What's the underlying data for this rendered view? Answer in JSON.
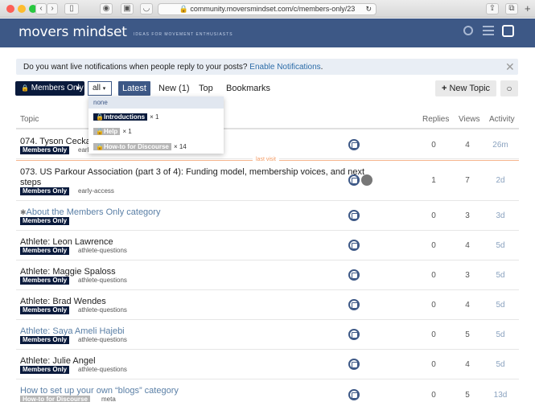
{
  "browser": {
    "url": "community.moversmindset.com/c/members-only/23"
  },
  "site": {
    "logo": "movers mindset",
    "tagline": "IDEAS FOR MOVEMENT ENTHUSIASTS"
  },
  "notice": {
    "text": "Do you want live notifications when people reply to your posts?",
    "link": "Enable Notifications",
    "tail": "."
  },
  "nav": {
    "category": "Members Only",
    "filter": "all",
    "latest": "Latest",
    "new": "New (1)",
    "top": "Top",
    "bookmarks": "Bookmarks",
    "new_topic": "New Topic"
  },
  "columns": {
    "topic": "Topic",
    "replies": "Replies",
    "views": "Views",
    "activity": "Activity"
  },
  "dropdown": {
    "none": "none",
    "items": [
      {
        "label": "Introductions",
        "count": "× 1"
      },
      {
        "label": "Help",
        "count": "× 1"
      },
      {
        "label": "How-to for Discourse",
        "count": "× 14"
      }
    ]
  },
  "last_visit": "last visit",
  "topics": [
    {
      "title": "074. Tyson Cecka: C",
      "badge": "Members Only",
      "tag": "early",
      "replies": "0",
      "views": "4",
      "activity": "26m"
    },
    {
      "title": "073. US Parkour Association (part 3 of 4): Funding model, membership voices, and next",
      "title2": "steps",
      "badge": "Members Only",
      "tag": "early-access",
      "replies": "1",
      "views": "7",
      "activity": "2d"
    },
    {
      "title": "About the Members Only category",
      "badge": "Members Only",
      "tag": "",
      "replies": "0",
      "views": "3",
      "activity": "3d"
    },
    {
      "title": "Athlete: Leon Lawrence",
      "badge": "Members Only",
      "tag": "athlete-questions",
      "replies": "0",
      "views": "4",
      "activity": "5d"
    },
    {
      "title": "Athlete: Maggie Spaloss",
      "badge": "Members Only",
      "tag": "athlete-questions",
      "replies": "0",
      "views": "3",
      "activity": "5d"
    },
    {
      "title": "Athlete: Brad Wendes",
      "badge": "Members Only",
      "tag": "athlete-questions",
      "replies": "0",
      "views": "4",
      "activity": "5d"
    },
    {
      "title": "Athlete: Saya Ameli Hajebi",
      "badge": "Members Only",
      "tag": "athlete-questions",
      "replies": "0",
      "views": "5",
      "activity": "5d"
    },
    {
      "title": "Athlete: Julie Angel",
      "badge": "Members Only",
      "tag": "athlete-questions",
      "replies": "0",
      "views": "4",
      "activity": "5d"
    },
    {
      "title": "How to set up your own “blogs” category",
      "badge": "How-to for Discourse",
      "tag": "meta",
      "replies": "0",
      "views": "5",
      "activity": "13d"
    }
  ]
}
